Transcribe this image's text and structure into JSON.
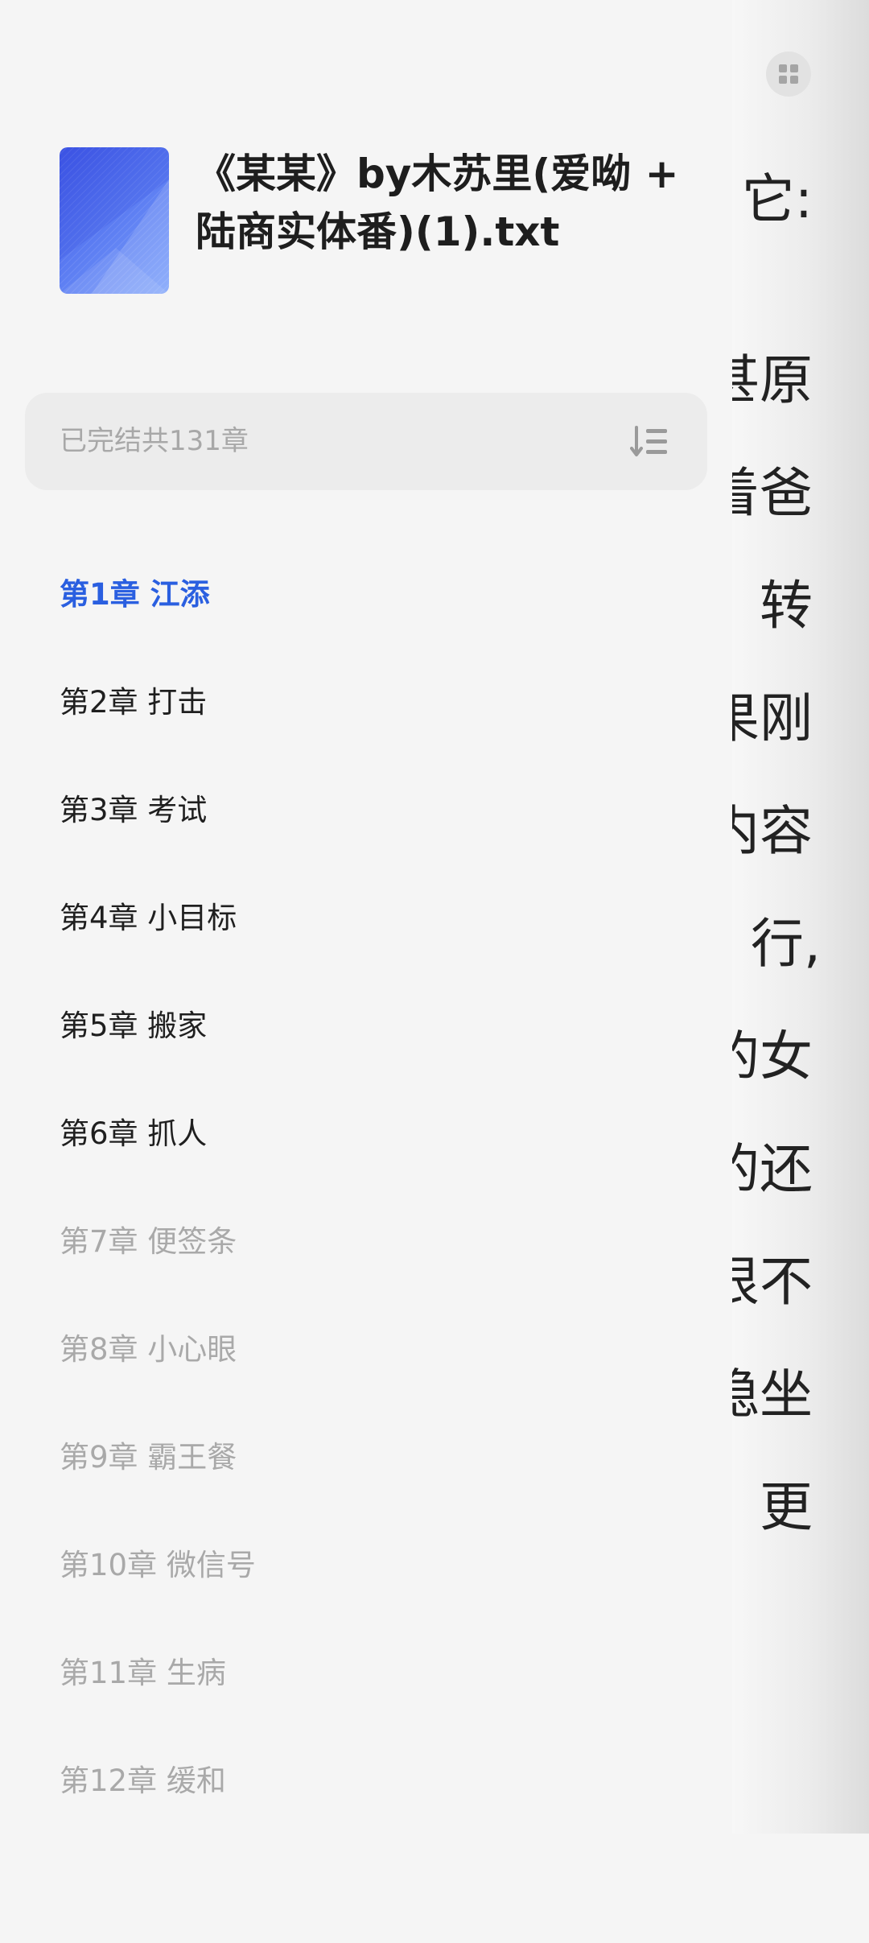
{
  "reader": {
    "lines": [
      "它:",
      "甚原",
      "着爸",
      "转",
      "果刚",
      "内容",
      "行,",
      "的女",
      "的还",
      "很不",
      "稳坐",
      "。更",
      "。"
    ]
  },
  "book": {
    "title": "《某某》by木苏里(爱呦 + 陆商实体番)(1).txt"
  },
  "status": {
    "text": "已完结共131章"
  },
  "icons": {
    "grid": "grid-icon",
    "sort": "sort-order-icon",
    "cover": "book-cover-icon"
  },
  "colors": {
    "accent": "#2a5fe0",
    "read": "#1f1f1f",
    "unread": "#a9a9a9"
  },
  "chapters": [
    {
      "label": "第1章 江添",
      "state": "current"
    },
    {
      "label": "第2章 打击",
      "state": "read"
    },
    {
      "label": "第3章 考试",
      "state": "read"
    },
    {
      "label": "第4章 小目标",
      "state": "read"
    },
    {
      "label": "第5章 搬家",
      "state": "read"
    },
    {
      "label": "第6章 抓人",
      "state": "read"
    },
    {
      "label": "第7章 便签条",
      "state": "unread"
    },
    {
      "label": "第8章 小心眼",
      "state": "unread"
    },
    {
      "label": "第9章 霸王餐",
      "state": "unread"
    },
    {
      "label": "第10章 微信号",
      "state": "unread"
    },
    {
      "label": "第11章 生病",
      "state": "unread"
    },
    {
      "label": "第12章 缓和",
      "state": "unread"
    }
  ]
}
